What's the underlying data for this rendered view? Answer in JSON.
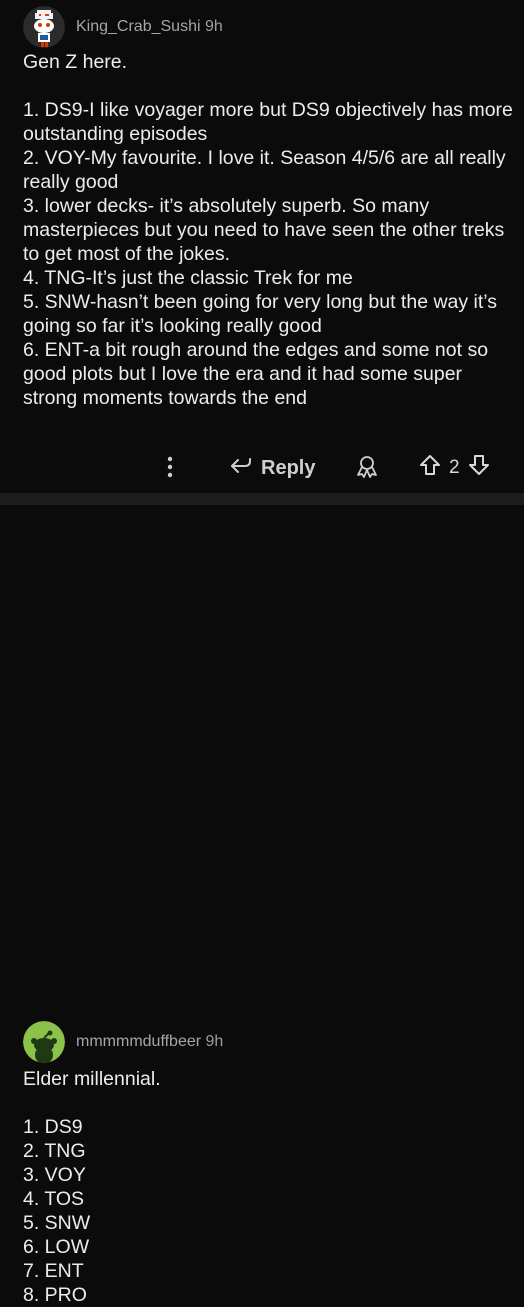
{
  "comments": [
    {
      "username": "King_Crab_Sushi",
      "time": "9h",
      "lines": [
        "Gen Z here.",
        "",
        "1. DS9-I like voyager more but DS9 objectively has more outstanding episodes",
        "2. VOY-My favourite. I love it. Season 4/5/6 are all really really good",
        "3. lower decks- it’s absolutely superb. So many masterpieces but you need to have seen the other treks to get most of the jokes.",
        "4. TNG-It’s just the classic Trek for me",
        "5. SNW-hasn’t been going for very long but the way it’s going so far it’s looking really good",
        "6. ENT-a bit rough around the edges and some not so good plots but I love the era and it had some super strong moments towards the end"
      ],
      "actions": {
        "more_icon": "more-vertical-icon",
        "reply_label": "Reply",
        "award_icon": "award-icon",
        "upvote_icon": "upvote-arrow-icon",
        "vote_count": "2",
        "downvote_icon": "downvote-arrow-icon"
      }
    },
    {
      "username": "mmmmmduffbeer",
      "time": "9h",
      "lines": [
        "Elder millennial.",
        "",
        "1. DS9",
        "2. TNG",
        "3. VOY",
        "4. TOS",
        "5. SNW",
        "6. LOW",
        "7. ENT",
        "8. PRO"
      ]
    }
  ],
  "colors": {
    "background": "#0b0b0b",
    "divider": "#1d1d1d",
    "text": "#ececec",
    "meta": "#9d9d9d",
    "avatar2_green": "#8ac24a"
  }
}
